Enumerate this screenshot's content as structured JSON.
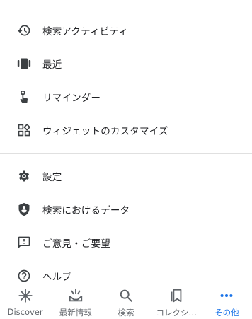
{
  "menu": {
    "group1": [
      {
        "label": "検索アクティビティ",
        "icon": "history-icon"
      },
      {
        "label": "最近",
        "icon": "recent-icon"
      },
      {
        "label": "リマインダー",
        "icon": "reminder-icon"
      },
      {
        "label": "ウィジェットのカスタマイズ",
        "icon": "widgets-icon"
      }
    ],
    "group2": [
      {
        "label": "設定",
        "icon": "gear-icon"
      },
      {
        "label": "検索におけるデータ",
        "icon": "shield-icon"
      },
      {
        "label": "ご意見・ご要望",
        "icon": "feedback-icon"
      },
      {
        "label": "ヘルプ",
        "icon": "help-icon"
      }
    ]
  },
  "bottom_nav": {
    "items": [
      {
        "label": "Discover",
        "icon": "discover-icon",
        "active": false
      },
      {
        "label": "最新情報",
        "icon": "updates-icon",
        "active": false
      },
      {
        "label": "検索",
        "icon": "search-icon",
        "active": false
      },
      {
        "label": "コレクシ…",
        "icon": "collections-icon",
        "active": false
      },
      {
        "label": "その他",
        "icon": "more-icon",
        "active": true
      }
    ]
  },
  "colors": {
    "text": "#202124",
    "icon": "#3c4043",
    "nav_inactive": "#5f6368",
    "accent": "#1a73e8",
    "divider": "#dadce0"
  }
}
